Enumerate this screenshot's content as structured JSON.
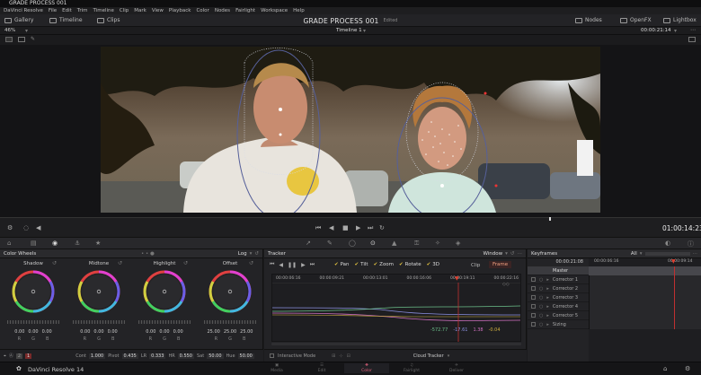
{
  "window": {
    "title": "GRADE PROCESS 001"
  },
  "menu": [
    "DaVinci Resolve",
    "File",
    "Edit",
    "Trim",
    "Timeline",
    "Clip",
    "Mark",
    "View",
    "Playback",
    "Color",
    "Nodes",
    "Fairlight",
    "Workspace",
    "Help"
  ],
  "toolbar": {
    "gallery": "Gallery",
    "timeline": "Timeline",
    "clips": "Clips",
    "project_title": "GRADE PROCESS 001",
    "project_status": "Edited",
    "nodes": "Nodes",
    "openfx": "OpenFX",
    "lightbox": "Lightbox"
  },
  "viewer": {
    "zoom": "46%",
    "timeline_name": "Timeline 1",
    "timecode_top": "00:00:21:14",
    "timecode": "01:00:14:23"
  },
  "color_wheels": {
    "title": "Color Wheels",
    "mode": "Log",
    "wheels": [
      {
        "label": "Shadow",
        "values": [
          "0.00",
          "0.00",
          "0.00"
        ]
      },
      {
        "label": "Midtone",
        "values": [
          "0.00",
          "0.00",
          "0.00"
        ]
      },
      {
        "label": "Highlight",
        "values": [
          "0.00",
          "0.00",
          "0.00"
        ]
      },
      {
        "label": "Offset",
        "values": [
          "25.00",
          "25.00",
          "25.00"
        ]
      }
    ],
    "rgb_letters": [
      "R",
      "G",
      "B"
    ],
    "footer": {
      "page": "1",
      "page_alt": "2",
      "contrast_label": "Cont",
      "contrast": "1.000",
      "pivot_label": "Pivot",
      "pivot": "0.435",
      "lr_label": "LR",
      "lr": "0.333",
      "hr_label": "HR",
      "hr": "0.550",
      "sat_label": "Sat",
      "sat": "50.00",
      "hue_label": "Hue",
      "hue": "50.00"
    }
  },
  "tracker": {
    "title": "Tracker",
    "mode": "Window",
    "checks": [
      "Pan",
      "Tilt",
      "Zoom",
      "Rotate",
      "3D"
    ],
    "clip_btn": "Clip",
    "frame_btn": "Frame",
    "times": [
      "00:00:06:16",
      "00:00:09:21",
      "00:00:13:01",
      "00:00:16:06",
      "00:00:19:11",
      "00:00:22:16"
    ],
    "values": [
      "-572.77",
      "-17.61",
      "1.38",
      "-0.04"
    ],
    "value_colors": [
      "#6cc08a",
      "#8a90e0",
      "#d070c0",
      "#d0b040"
    ],
    "interactive": "Interactive Mode",
    "cloud": "Cloud Tracker"
  },
  "keyframes": {
    "title": "Keyframes",
    "filter": "All",
    "time_left": "00:00:21:08",
    "time_mid": "00:00:06:16",
    "time_right": "00:00:09:14",
    "rows": [
      "Master",
      "Corrector 1",
      "Corrector 2",
      "Corrector 3",
      "Corrector 4",
      "Corrector 5",
      "Sizing"
    ]
  },
  "footer": {
    "app": "DaVinci Resolve 14",
    "pages": [
      "Media",
      "Edit",
      "Color",
      "Fairlight",
      "Deliver"
    ],
    "active": "Color"
  }
}
